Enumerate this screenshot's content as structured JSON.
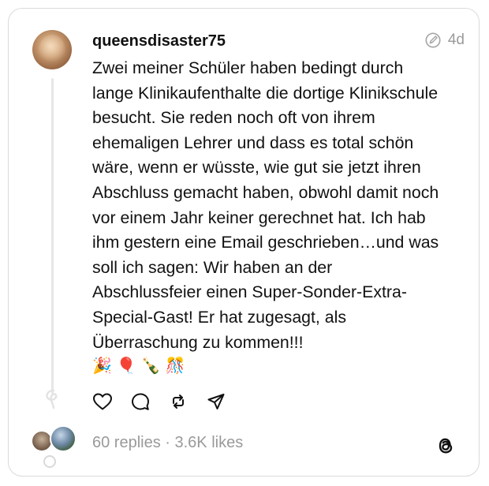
{
  "post": {
    "username": "queensdisaster75",
    "time": "4d",
    "lines": [
      "Zwei meiner Schüler haben bedingt durch",
      "lange Klinikaufenthalte die dortige Klinikschule",
      "besucht. Sie reden noch oft von ihrem",
      "ehemaligen Lehrer und dass es total schön",
      "wäre, wenn er wüsste, wie gut sie jetzt ihren",
      "Abschluss gemacht haben, obwohl damit noch",
      "vor einem Jahr keiner gerechnet hat. Ich hab",
      "ihm gestern eine Email geschrieben…und was",
      "soll ich sagen: Wir haben an der",
      "Abschlussfeier einen Super-Sonder-Extra-",
      "Special-Gast! Er hat zugesagt, als",
      "Überraschung zu kommen!!!"
    ],
    "emojis": [
      "🎉",
      "🎈",
      "🍾",
      "🎊"
    ]
  },
  "footer": {
    "stats": "60 replies · 3.6K likes"
  },
  "icons": {
    "edit": "edited-icon",
    "like": "heart-icon",
    "reply": "comment-icon",
    "repost": "repost-icon",
    "share": "share-icon",
    "brand": "threads-logo-icon"
  }
}
